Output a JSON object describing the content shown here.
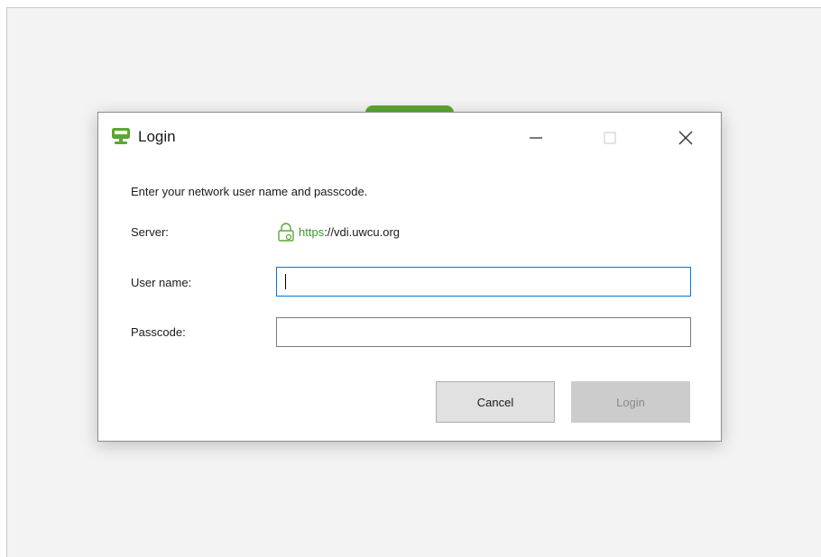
{
  "dialog": {
    "title": "Login",
    "instructions": "Enter your network user name and passcode.",
    "server": {
      "label": "Server:",
      "protocol": "https",
      "rest": "://vdi.uwcu.org"
    },
    "username": {
      "label": "User name:",
      "value": ""
    },
    "passcode": {
      "label": "Passcode:",
      "value": ""
    },
    "buttons": {
      "cancel": "Cancel",
      "login": "Login"
    }
  },
  "colors": {
    "brand_green": "#5aa832",
    "protocol_green": "#3b9a2a",
    "focus_blue": "#0078d7"
  },
  "icons": {
    "app": "monitor-icon",
    "lock": "lock-icon",
    "minimize": "minimize-icon",
    "maximize": "maximize-icon",
    "close": "close-icon"
  }
}
